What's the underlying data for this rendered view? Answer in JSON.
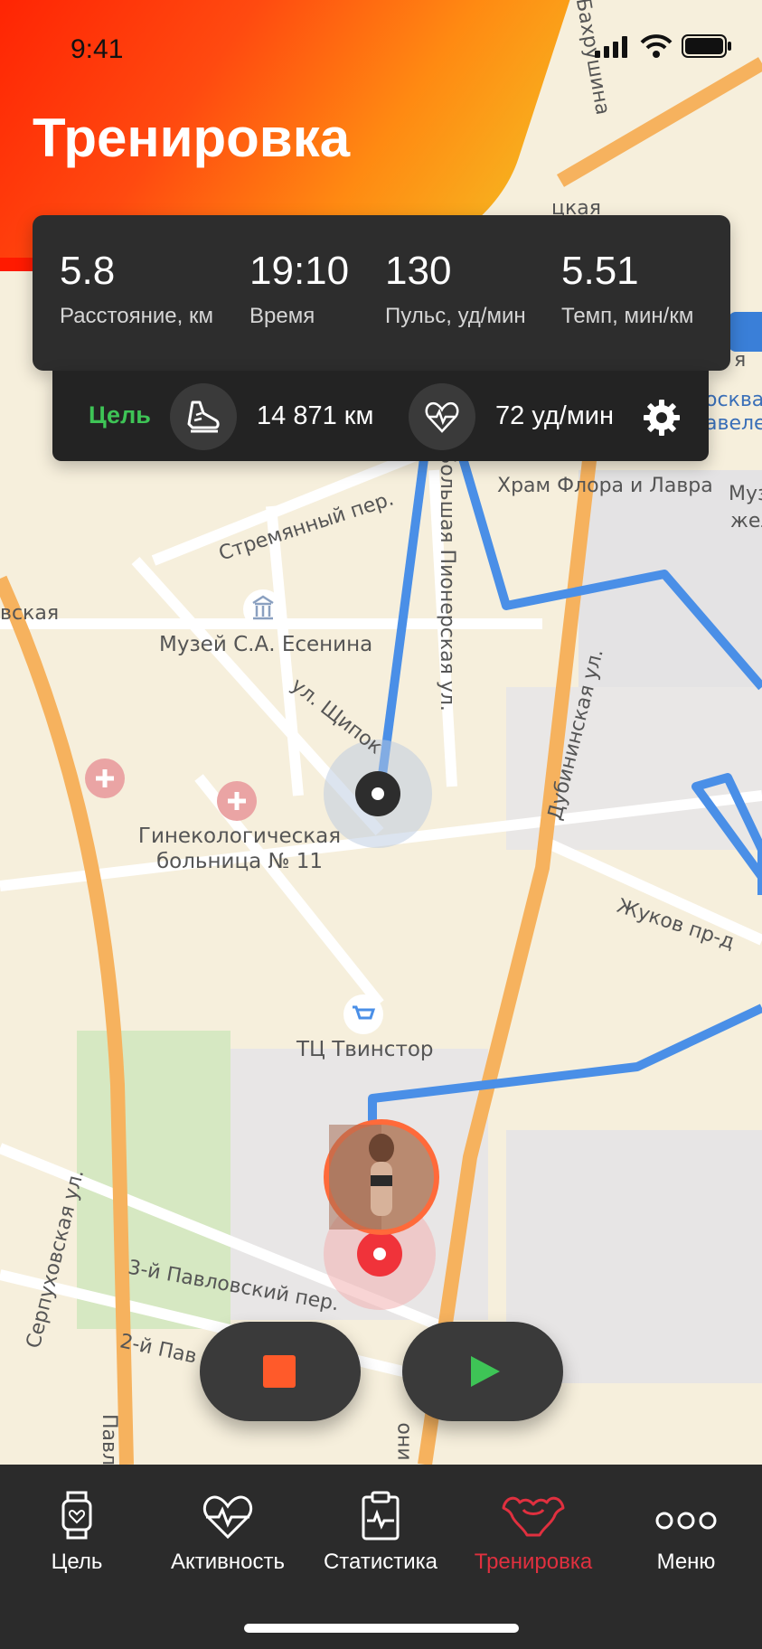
{
  "status_bar": {
    "time": "9:41"
  },
  "header": {
    "title": "Тренировка"
  },
  "stats": [
    {
      "value": "5.8",
      "label": "Расстояние, км"
    },
    {
      "value": "19:10",
      "label": "Время"
    },
    {
      "value": "130",
      "label": "Пульс, уд/мин"
    },
    {
      "value": "5.51",
      "label": "Темп, мин/км"
    }
  ],
  "goal": {
    "label": "Цель",
    "distance": "14 871 км",
    "pulse": "72 уд/мин"
  },
  "map_labels": {
    "temple": "Храм Флора и Лавра",
    "museum": "Музей С.А. Есенина",
    "hospital": "Гинекологическая больница № 11",
    "mall": "ТЦ Твинстор",
    "street_stremyanny": "Стремянный пер.",
    "street_pionerskaya": "Большая Пионерская ул.",
    "street_dubininskaya": "Дубининская ул.",
    "street_shchipok": "ул. Щипок",
    "street_zhukov": "Жуков пр-д",
    "street_pavlovsky3": "3-й Павловский пер.",
    "street_pavlovsky2": "2-й Пав",
    "street_serpukhovskaya": "Серпуховская ул.",
    "street_bakhrushina": "Бахрушина",
    "frag_vskaya": "вская",
    "frag_tskaya": "цкая",
    "frag_moskva": "осква",
    "frag_paveleckaya": "авелец",
    "frag_ya": "я",
    "frag_muz": "Муз",
    "frag_zhel": "жел",
    "frag_pavl": "Павл",
    "frag_ino": "ино"
  },
  "controls": {
    "stop": "stop",
    "play": "play"
  },
  "tabs": [
    {
      "label": "Цель",
      "icon": "watch-icon"
    },
    {
      "label": "Активность",
      "icon": "heart-pulse-icon"
    },
    {
      "label": "Статистика",
      "icon": "clipboard-pulse-icon"
    },
    {
      "label": "Тренировка",
      "icon": "muscle-icon",
      "active": true
    },
    {
      "label": "Меню",
      "icon": "more-icon"
    }
  ],
  "colors": {
    "accent": "#e0303f",
    "goal": "#3ec456",
    "route": "#4a8fe7",
    "stop": "#ff5a2a",
    "play": "#3ec456"
  }
}
